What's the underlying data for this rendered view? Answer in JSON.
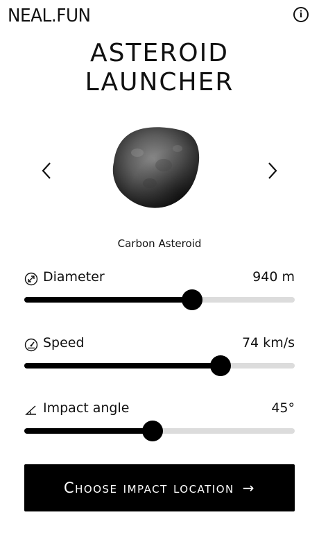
{
  "header": {
    "logo": "NEAL.FUN",
    "info_icon": "i"
  },
  "title": {
    "line1": "ASTEROID",
    "line2": "LAUNCHER"
  },
  "carousel": {
    "prev_icon": "chevron-left-icon",
    "next_icon": "chevron-right-icon",
    "asteroid_name": "Carbon Asteroid"
  },
  "sliders": [
    {
      "label": "Diameter",
      "value": "940 m",
      "icon": "diameter-icon",
      "fraction": 0.62
    },
    {
      "label": "Speed",
      "value": "74 km/s",
      "icon": "speedometer-icon",
      "fraction": 0.725
    },
    {
      "label": "Impact angle",
      "value": "45°",
      "icon": "angle-icon",
      "fraction": 0.475
    }
  ],
  "cta": {
    "label": "Choose impact location",
    "arrow": "→"
  },
  "colors": {
    "accent": "#000000",
    "track": "#dcdcdc",
    "background": "#ffffff"
  }
}
